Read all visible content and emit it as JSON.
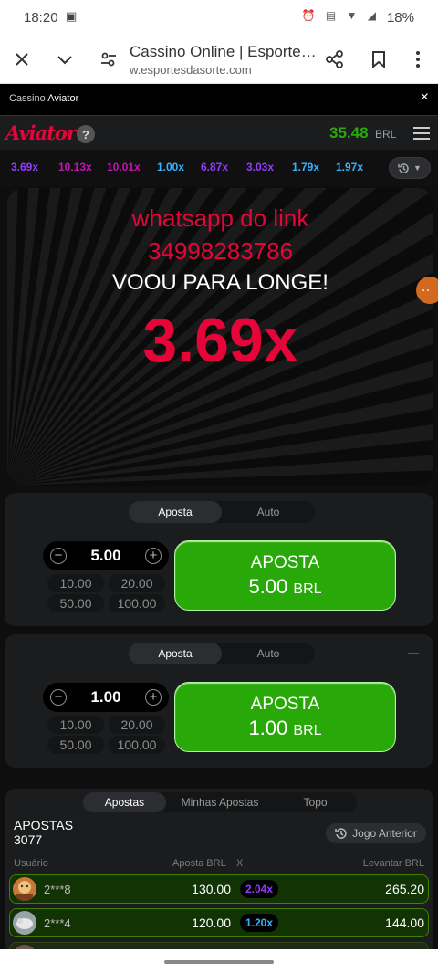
{
  "status_bar": {
    "time": "18:20",
    "battery": "18%"
  },
  "browser": {
    "title": "Cassino Online | Esportes da Sorte",
    "url": "w.esportesdasorte.com"
  },
  "cassino_bar": {
    "prefix": "Cassino",
    "name": "Aviator",
    "close": "×"
  },
  "game_header": {
    "logo": "Aviator",
    "help": "?",
    "balance": "35.48",
    "currency": "BRL"
  },
  "history": [
    {
      "value": "3.69x",
      "color": "#913ef8"
    },
    {
      "value": "10.13x",
      "color": "#c017b4"
    },
    {
      "value": "10.01x",
      "color": "#c017b4"
    },
    {
      "value": "1.00x",
      "color": "#34b4ff"
    },
    {
      "value": "6.87x",
      "color": "#913ef8"
    },
    {
      "value": "3.03x",
      "color": "#913ef8"
    },
    {
      "value": "1.79x",
      "color": "#34b4ff"
    },
    {
      "value": "1.97x",
      "color": "#34b4ff"
    }
  ],
  "stage": {
    "promo_line1": "whatsapp do link",
    "promo_line2": "34998283786",
    "flew_away": "VOOU PARA LONGE!",
    "multiplier": "3.69x"
  },
  "bet_panels": [
    {
      "tabs": [
        "Aposta",
        "Auto"
      ],
      "amount": "5.00",
      "quick": [
        "10.00",
        "20.00",
        "50.00",
        "100.00"
      ],
      "button_label": "APOSTA",
      "button_amount": "5.00",
      "button_currency": "BRL"
    },
    {
      "tabs": [
        "Aposta",
        "Auto"
      ],
      "amount": "1.00",
      "quick": [
        "10.00",
        "20.00",
        "50.00",
        "100.00"
      ],
      "button_label": "APOSTA",
      "button_amount": "1.00",
      "button_currency": "BRL"
    }
  ],
  "bets": {
    "tabs": [
      "Apostas",
      "Minhas Apostas",
      "Topo"
    ],
    "title": "APOSTAS",
    "count": "3077",
    "previous_game": "Jogo Anterior",
    "columns": {
      "user": "Usuário",
      "bet": "Aposta BRL",
      "x": "X",
      "cashout": "Levantar BRL"
    },
    "rows": [
      {
        "user": "2***8",
        "bet": "130.00",
        "x": "2.04x",
        "x_color": "#913ef8",
        "cashout": "265.20"
      },
      {
        "user": "2***4",
        "bet": "120.00",
        "x": "1.20x",
        "x_color": "#34b4ff",
        "cashout": "144.00"
      }
    ]
  }
}
